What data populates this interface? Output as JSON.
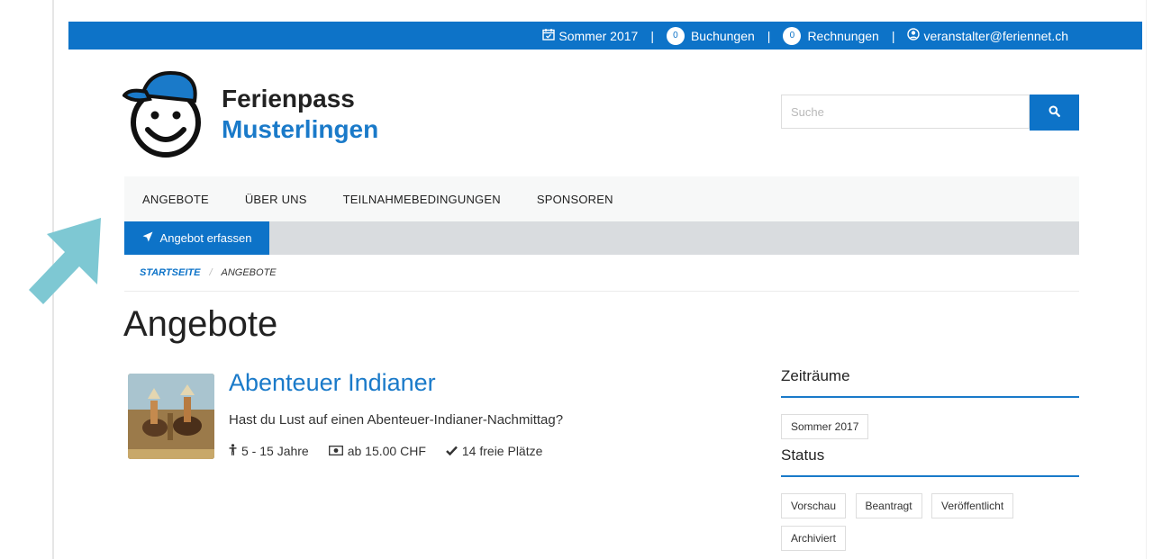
{
  "topbar": {
    "period": "Sommer 2017",
    "bookings_count": "0",
    "bookings_label": "Buchungen",
    "invoices_count": "0",
    "invoices_label": "Rechnungen",
    "user_email": "veranstalter@feriennet.ch",
    "separator": "|"
  },
  "logo": {
    "line1": "Ferienpass",
    "line2": "Musterlingen"
  },
  "search": {
    "placeholder": "Suche"
  },
  "nav": {
    "items": [
      "ANGEBOTE",
      "ÜBER UNS",
      "TEILNAHMEBEDINGUNGEN",
      "SPONSOREN"
    ]
  },
  "subnav": {
    "button_label": "Angebot erfassen"
  },
  "breadcrumb": {
    "home": "STARTSEITE",
    "separator": "/",
    "current": "ANGEBOTE"
  },
  "page": {
    "title": "Angebote"
  },
  "offer": {
    "title": "Abenteuer Indianer",
    "description": "Hast du Lust auf einen Abenteuer-Indianer-Nachmittag?",
    "age": "5 - 15 Jahre",
    "price": "ab 15.00 CHF",
    "spots": "14 freie Plätze"
  },
  "sidebar": {
    "periods_heading": "Zeiträume",
    "periods": [
      "Sommer 2017"
    ],
    "status_heading": "Status",
    "statuses": [
      "Vorschau",
      "Beantragt",
      "Veröffentlicht",
      "Archiviert"
    ]
  },
  "colors": {
    "primary": "#0d73c8",
    "link": "#1a7ac9",
    "annotation_arrow": "#7ec8d3"
  }
}
